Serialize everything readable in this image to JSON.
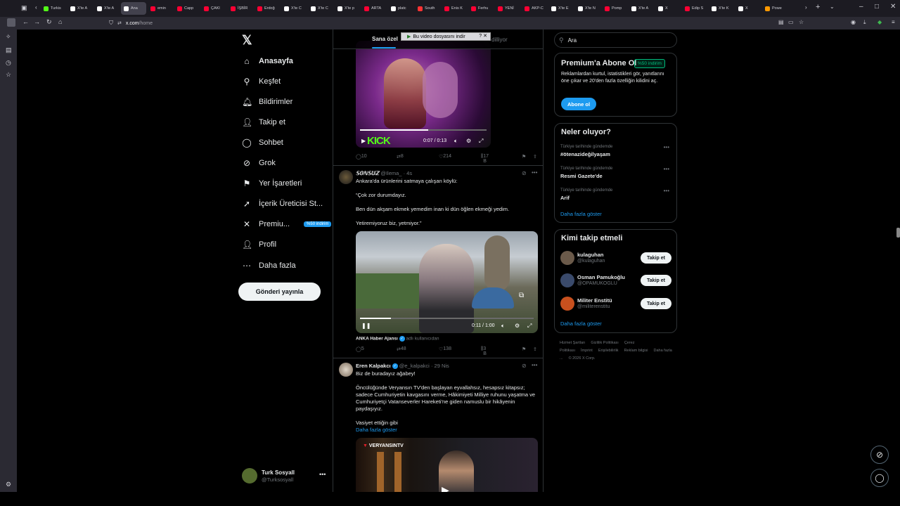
{
  "browser": {
    "tabs": [
      {
        "label": "Turkis",
        "color": "#53fc18"
      },
      {
        "label": "X'te A",
        "color": "#ffffff"
      },
      {
        "label": "X'te A",
        "color": "#ffffff"
      },
      {
        "label": "Ana",
        "color": "#ffffff",
        "active": true
      },
      {
        "label": "emin",
        "color": "#ff0033"
      },
      {
        "label": "Capp",
        "color": "#ff0033"
      },
      {
        "label": "ÇAKI",
        "color": "#ff0033"
      },
      {
        "label": "İŞBİR",
        "color": "#ff0033"
      },
      {
        "label": "Erdoğ",
        "color": "#ff0033"
      },
      {
        "label": "X'te C",
        "color": "#ffffff"
      },
      {
        "label": "X'te C",
        "color": "#ffffff"
      },
      {
        "label": "X'te p",
        "color": "#ffffff"
      },
      {
        "label": "ARTA",
        "color": "#ff0033"
      },
      {
        "label": "platc",
        "color": "#ffffff"
      },
      {
        "label": "South",
        "color": "#ff3333"
      },
      {
        "label": "Enis K",
        "color": "#ff0033"
      },
      {
        "label": "Ferhu",
        "color": "#ff0033"
      },
      {
        "label": "YENİ",
        "color": "#ff0033"
      },
      {
        "label": "AKP-C",
        "color": "#ff0033"
      },
      {
        "label": "X'te E",
        "color": "#ffffff"
      },
      {
        "label": "X'te N",
        "color": "#ffffff"
      },
      {
        "label": "Pomp",
        "color": "#ff0033"
      },
      {
        "label": "X'te A",
        "color": "#ffffff"
      },
      {
        "label": "X",
        "color": "#ffffff"
      },
      {
        "label": "Edip S",
        "color": "#ff0033"
      },
      {
        "label": "X'te K",
        "color": "#ffffff"
      },
      {
        "label": "X",
        "color": "#ffffff"
      },
      {
        "label": "Powe",
        "color": "#ff9900"
      }
    ],
    "url_host": "x.com",
    "url_path": "/home",
    "download_popup": "Bu video dosyasını indir"
  },
  "nav": {
    "items": [
      {
        "label": "Anasayfa",
        "icon": "home-icon",
        "glyph": "⌂"
      },
      {
        "label": "Keşfet",
        "icon": "search-icon",
        "glyph": "⚲"
      },
      {
        "label": "Bildirimler",
        "icon": "bell-icon",
        "glyph": "🔔︎"
      },
      {
        "label": "Takip et",
        "icon": "follow-icon",
        "glyph": "👤︎"
      },
      {
        "label": "Sohbet",
        "icon": "chat-icon",
        "glyph": "◯"
      },
      {
        "label": "Grok",
        "icon": "grok-icon",
        "glyph": "⊘"
      },
      {
        "label": "Yer İşaretleri",
        "icon": "bookmark-icon",
        "glyph": "⚑"
      },
      {
        "label": "İçerik Üreticisi St...",
        "icon": "rocket-icon",
        "glyph": "➚"
      },
      {
        "label": "Premiu...",
        "icon": "x-premium-icon",
        "glyph": "✕"
      },
      {
        "label": "Profil",
        "icon": "profile-icon",
        "glyph": "👤︎"
      },
      {
        "label": "Daha fazla",
        "icon": "more-icon",
        "glyph": "⋯"
      }
    ],
    "premium_badge": "%50 indirim",
    "post_button": "Gönderi yayınla",
    "account_name": "Turk Sosyall",
    "account_handle": "@Turksosyall"
  },
  "timeline": {
    "tab_for_you": "Sana özel",
    "tab_following": "dilliyor",
    "tweet1": {
      "video_time": "0:07 / 0:13",
      "watermark": "KICK",
      "replies": "10",
      "reposts": "8",
      "likes": "214",
      "views": "17 B"
    },
    "tweet2": {
      "name": "𝕊𝕆ℕ𝕊𝕌ℤ",
      "handle": "@Ilema_",
      "time": "4s",
      "lines": [
        "Ankara'da ürünlerini satmaya çalışan köylü:",
        "“Çok zor durumdayız.",
        "Ben dün akşam ekmek yemedim inan ki dün öğlen ekmeği yedim.",
        "Yetiremiyoruz biz, yetmiyor.”"
      ],
      "video_time": "0:11 / 1:00",
      "source_name": "ANKA Haber Ajansı",
      "source_sub": "adlı kullanıcıdan",
      "replies": "5",
      "reposts": "48",
      "likes": "138",
      "views": "3 B"
    },
    "tweet3": {
      "name": "Eren Kalpakcı",
      "handle": "@e_kalpakci",
      "time": "29 Nis",
      "lines": [
        "Biz de buradayız ağabey!",
        "Öncülüğünde Veryansın TV'den başlayan eyvallahsız, hesapsız kitapsız; sadece Cumhuriyetin kavgasını verme, Hâkimiyeti Milliye ruhunu yaşatma ve  Cumhuriyetçi Vatanseverler Hareketi'ne giden namuslu bir hikâyenin paydaşıyız.",
        "Vasiyet ettiğin gibi"
      ],
      "show_more": "Daha fazla göster",
      "video_logo": "VERYANSINTV"
    }
  },
  "right": {
    "search_placeholder": "Ara",
    "premium": {
      "title": "Premium'a Abone Ol",
      "badge": "%50 indirim",
      "text": "Reklamlardan kurtul, istatistikleri gör, yanıtlarını öne çıkar ve 20'den fazla özelliğin kilidini aç.",
      "button": "Abone ol"
    },
    "trends": {
      "title": "Neler oluyor?",
      "items": [
        {
          "meta": "Türkiye tarihinde gündemde",
          "name": "#ötenazideğilyaşam"
        },
        {
          "meta": "Türkiye tarihinde gündemde",
          "name": "Resmi Gazete'de"
        },
        {
          "meta": "Türkiye tarihinde gündemde",
          "name": "Arif"
        }
      ],
      "show_more": "Daha fazla göster"
    },
    "who_to_follow": {
      "title": "Kimi takip etmeli",
      "items": [
        {
          "name": "kulaguhan",
          "handle": "@kulaguhan",
          "button": "Takip et",
          "color": "#6b5a4a"
        },
        {
          "name": "Osman Pamukoğlu",
          "handle": "@OPAMUKOGLU",
          "button": "Takip et",
          "color": "#3a4a6b"
        },
        {
          "name": "Militer Enstitü",
          "handle": "@militerenstitu",
          "button": "Takip et",
          "color": "#c8501e"
        }
      ],
      "show_more": "Daha fazla göster"
    },
    "footer": [
      "Hizmet Şartları",
      "Gizlilik Politikası",
      "Çerez Politikası",
      "İmprint",
      "Erişilebilirlik",
      "Reklam bilgisi",
      "Daha fazla ...",
      "© 2026 X Corp."
    ]
  }
}
